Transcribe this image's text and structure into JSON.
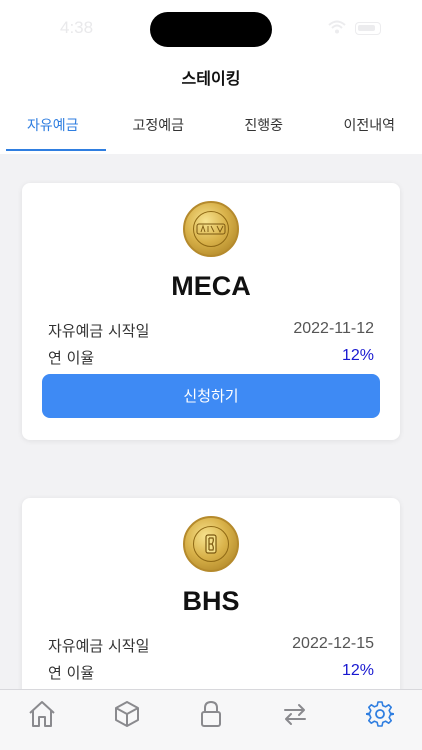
{
  "status_bar": {
    "time": "4:38"
  },
  "header": {
    "title": "스테이킹"
  },
  "tabs": [
    {
      "label": "자유예금",
      "active": true
    },
    {
      "label": "고정예금",
      "active": false
    },
    {
      "label": "진행중",
      "active": false
    },
    {
      "label": "이전내역",
      "active": false
    }
  ],
  "cards": [
    {
      "coin": "MECA",
      "coin_icon": "meca-coin-icon",
      "start_label": "자유예금 시작일",
      "start_date": "2022-11-12",
      "rate_label": "연 이율",
      "rate": "12%",
      "apply_label": "신청하기"
    },
    {
      "coin": "BHS",
      "coin_icon": "bhs-coin-icon",
      "start_label": "자유예금 시작일",
      "start_date": "2022-12-15",
      "rate_label": "연 이율",
      "rate": "12%"
    }
  ],
  "bottom_nav": [
    {
      "icon": "home-icon",
      "active": false
    },
    {
      "icon": "cube-icon",
      "active": false
    },
    {
      "icon": "lock-icon",
      "active": false
    },
    {
      "icon": "transfer-icon",
      "active": false
    },
    {
      "icon": "settings-icon",
      "active": true
    }
  ],
  "colors": {
    "accent": "#2f7ee0",
    "button": "#3e8af4",
    "rate": "#1818d0",
    "coin_gold": "#d9b24a"
  }
}
